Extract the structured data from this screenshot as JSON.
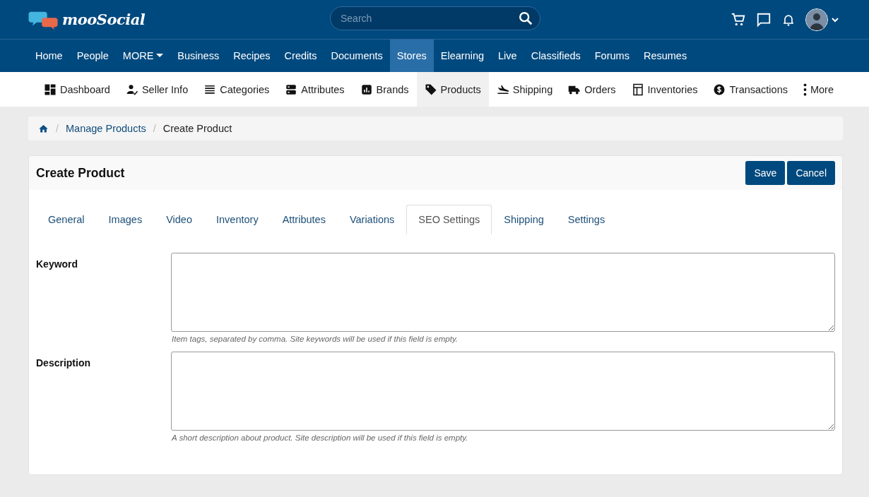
{
  "header": {
    "logo": "mooSocial",
    "search": {
      "placeholder": "Search"
    }
  },
  "main_nav": [
    {
      "label": "Home",
      "selected": false
    },
    {
      "label": "People",
      "selected": false
    },
    {
      "label": "MORE",
      "selected": false,
      "kind": "dropdown"
    },
    {
      "label": "Business",
      "selected": false
    },
    {
      "label": "Recipes",
      "selected": false
    },
    {
      "label": "Credits",
      "selected": false
    },
    {
      "label": "Documents",
      "selected": false
    },
    {
      "label": "Stores",
      "selected": true
    },
    {
      "label": "Elearning",
      "selected": false
    },
    {
      "label": "Live",
      "selected": false
    },
    {
      "label": "Classifieds",
      "selected": false
    },
    {
      "label": "Forums",
      "selected": false
    },
    {
      "label": "Resumes",
      "selected": false
    }
  ],
  "store_nav": [
    {
      "label": "Dashboard",
      "selected": false
    },
    {
      "label": "Seller Info",
      "selected": false
    },
    {
      "label": "Categories",
      "selected": false
    },
    {
      "label": "Attributes",
      "selected": false
    },
    {
      "label": "Brands",
      "selected": false
    },
    {
      "label": "Products",
      "selected": true
    },
    {
      "label": "Shipping",
      "selected": false
    },
    {
      "label": "Orders",
      "selected": false
    },
    {
      "label": "Inventories",
      "selected": false
    },
    {
      "label": "Transactions",
      "selected": false
    },
    {
      "label": "More",
      "selected": false
    }
  ],
  "breadcrumb": [
    {
      "separator": "/",
      "label": "Manage Products"
    },
    {
      "separator": "/",
      "label": "Create Product"
    }
  ],
  "card": {
    "title": "Create Product",
    "buttons": [
      "Save",
      "Cancel"
    ],
    "tabs": [
      {
        "label": "General",
        "selected": false
      },
      {
        "label": "Images",
        "selected": false
      },
      {
        "label": "Video",
        "selected": false
      },
      {
        "label": "Inventory",
        "selected": false
      },
      {
        "label": "Attributes",
        "selected": false
      },
      {
        "label": "Variations",
        "selected": false
      },
      {
        "label": "SEO Settings",
        "selected": true
      },
      {
        "label": "Shipping",
        "selected": false
      },
      {
        "label": "Settings",
        "selected": false
      }
    ],
    "fields": [
      {
        "label": "Keyword",
        "help": "Item tags, separated by comma. Site keywords will be used if this field is empty."
      },
      {
        "label": "Description",
        "help": "A short description about product. Site description will be used if this field is empty."
      }
    ]
  }
}
